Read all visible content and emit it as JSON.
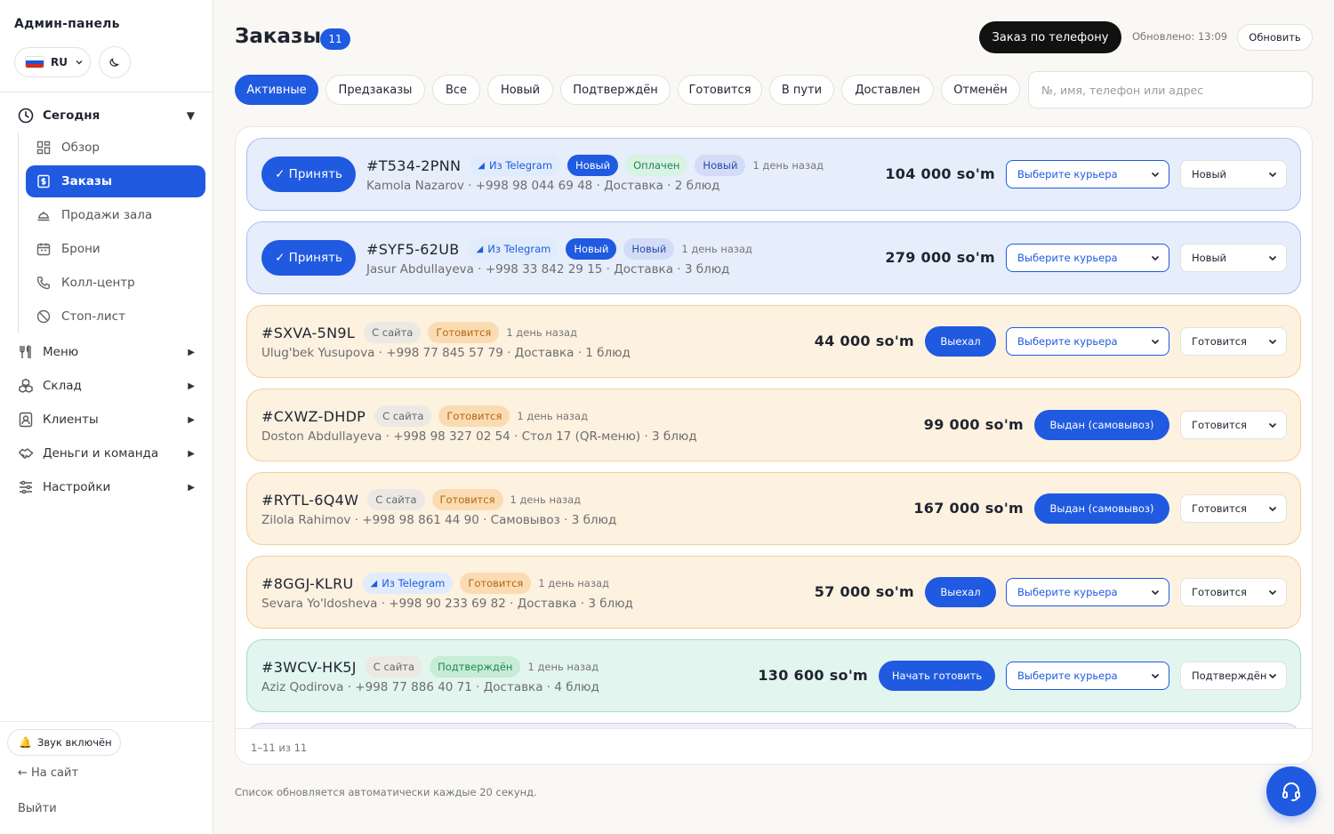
{
  "sidebar": {
    "title": "Админ-панель",
    "lang": "RU",
    "groups": [
      {
        "label": "Сегодня",
        "icon": "clock-icon",
        "open": true
      },
      {
        "label": "Меню",
        "icon": "utensils-icon"
      },
      {
        "label": "Склад",
        "icon": "boxes-icon"
      },
      {
        "label": "Клиенты",
        "icon": "contact-card-icon"
      },
      {
        "label": "Деньги и команда",
        "icon": "handshake-icon"
      },
      {
        "label": "Настройки",
        "icon": "sliders-icon"
      }
    ],
    "today_items": [
      {
        "label": "Обзор",
        "icon": "dashboard-grid-icon"
      },
      {
        "label": "Заказы",
        "icon": "receipt-icon",
        "active": true
      },
      {
        "label": "Продажи зала",
        "icon": "cloche-icon"
      },
      {
        "label": "Брони",
        "icon": "calendar-icon"
      },
      {
        "label": "Колл-центр",
        "icon": "phone-icon"
      },
      {
        "label": "Стоп-лист",
        "icon": "ban-icon"
      }
    ],
    "sound": "Звук включён",
    "to_site": "← На сайт",
    "logout": "Выйти"
  },
  "header": {
    "title": "Заказы",
    "count": "11",
    "phone_order": "Заказ по телефону",
    "updated": "Обновлено: 13:09",
    "refresh": "Обновить"
  },
  "filters": [
    {
      "label": "Активные",
      "active": true
    },
    {
      "label": "Предзаказы"
    },
    {
      "label": "Все"
    },
    {
      "label": "Новый"
    },
    {
      "label": "Подтверждён"
    },
    {
      "label": "Готовится"
    },
    {
      "label": "В пути"
    },
    {
      "label": "Доставлен"
    },
    {
      "label": "Отменён"
    }
  ],
  "search": {
    "placeholder": "№, имя, телефон или адрес"
  },
  "orders": [
    {
      "accept": "✓ Принять",
      "id": "#T534-2PNN",
      "source": "Из Telegram",
      "badges": [
        "Новый",
        "Оплачен",
        "Новый"
      ],
      "time": "1 день назад",
      "details": "Kamola Nazarov · +998 98 044 69 48 · Доставка · 2 блюд",
      "price": "104 000 so'm",
      "courier": "Выберите курьера",
      "status": "Новый"
    },
    {
      "accept": "✓ Принять",
      "id": "#SYF5-62UB",
      "source": "Из Telegram",
      "badges": [
        "Новый",
        "Новый"
      ],
      "time": "1 день назад",
      "details": "Jasur Abdullayeva · +998 33 842 29 15 · Доставка · 3 блюд",
      "price": "279 000 so'm",
      "courier": "Выберите курьера",
      "status": "Новый"
    },
    {
      "id": "#SXVA-5N9L",
      "source": "С сайта",
      "badges": [
        "Готовится"
      ],
      "time": "1 день назад",
      "details": "Ulug'bek Yusupova · +998 77 845 57 79 · Доставка · 1 блюд",
      "price": "44 000 so'm",
      "action": "Выехал",
      "courier": "Выберите курьера",
      "status": "Готовится"
    },
    {
      "id": "#CXWZ-DHDP",
      "source": "С сайта",
      "badges": [
        "Готовится"
      ],
      "time": "1 день назад",
      "details": "Doston Abdullayeva · +998 98 327 02 54 · Стол 17 (QR-меню) · 3 блюд",
      "price": "99 000 so'm",
      "action": "Выдан (самовывоз)",
      "status": "Готовится"
    },
    {
      "id": "#RYTL-6Q4W",
      "source": "С сайта",
      "badges": [
        "Готовится"
      ],
      "time": "1 день назад",
      "details": "Zilola Rahimov · +998 98 861 44 90 · Самовывоз · 3 блюд",
      "price": "167 000 so'm",
      "action": "Выдан (самовывоз)",
      "status": "Готовится"
    },
    {
      "id": "#8GGJ-KLRU",
      "source": "Из Telegram",
      "badges": [
        "Готовится"
      ],
      "time": "1 день назад",
      "details": "Sevara Yo'ldosheva · +998 90 233 69 82 · Доставка · 3 блюд",
      "price": "57 000 so'm",
      "action": "Выехал",
      "courier": "Выберите курьера",
      "status": "Готовится"
    },
    {
      "id": "#3WCV-HK5J",
      "source": "С сайта",
      "badges": [
        "Подтверждён"
      ],
      "time": "1 день назад",
      "details": "Aziz Qodirova · +998 77 886 40 71 · Доставка · 4 блюд",
      "price": "130 600 so'm",
      "action": "Начать готовить",
      "courier": "Выберите курьера",
      "status": "Подтверждён"
    }
  ],
  "pager": "1–11 из 11",
  "footnote": "Список обновляется автоматически каждые 20 секунд.",
  "colors": {
    "accent": "#1f5ae0",
    "new_bg": "#e6edfb",
    "cooking_bg": "#fdf1e0",
    "confirmed_bg": "#e3f5ef"
  }
}
